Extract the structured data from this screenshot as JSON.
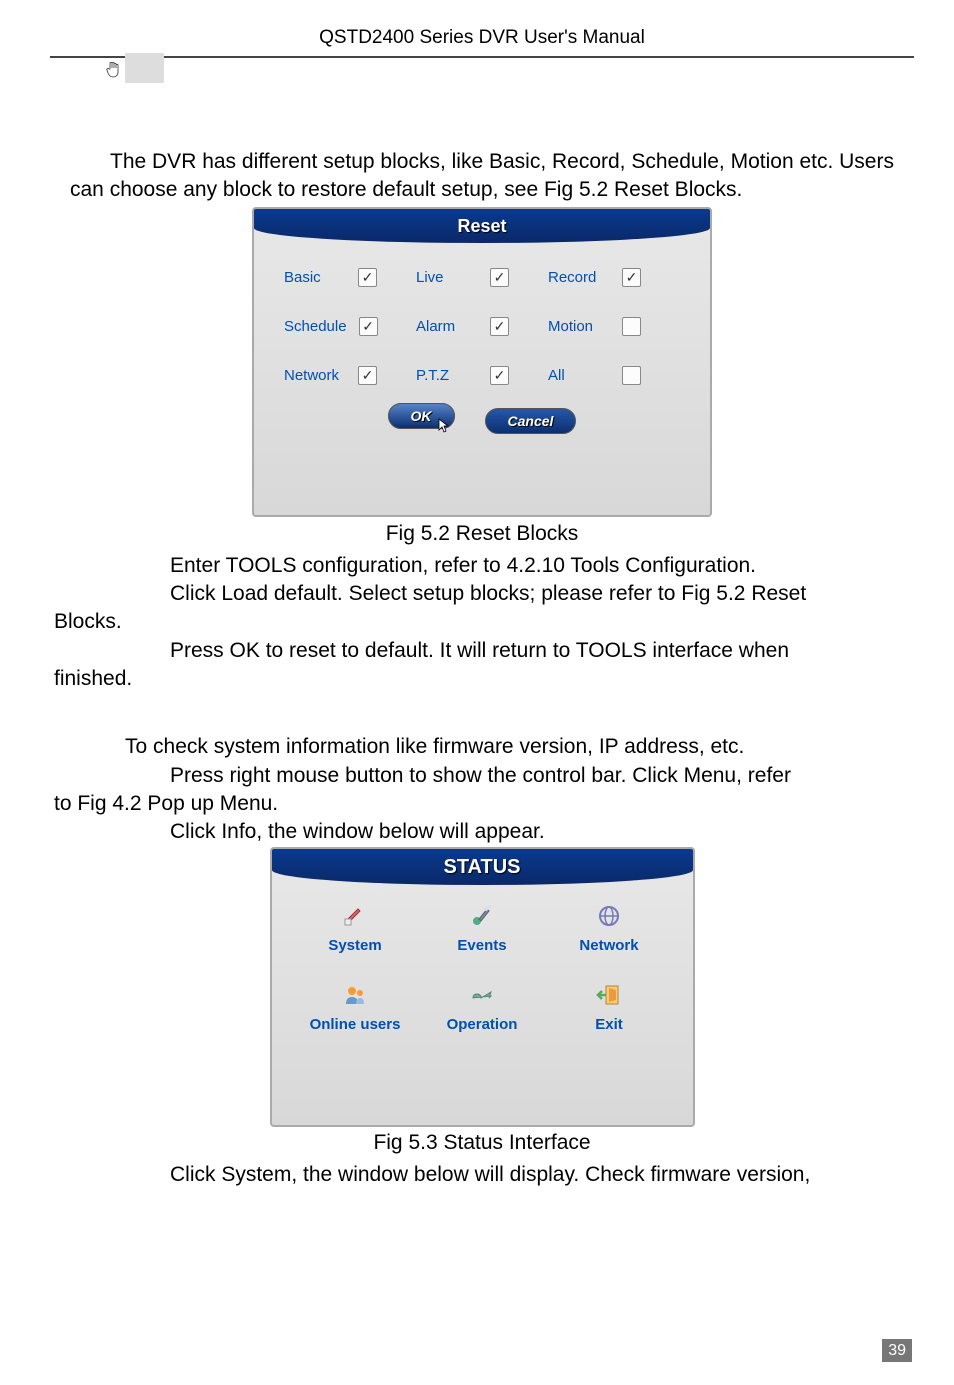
{
  "header": {
    "title": "QSTD2400 Series DVR User's Manual"
  },
  "page_number": "39",
  "paragraphs": {
    "p1": "The DVR has different setup blocks, like Basic, Record, Schedule, Motion etc. Users can choose any block to restore default setup, see Fig 5.2 Reset Blocks.",
    "caption1": "Fig 5.2 Reset Blocks",
    "p2": "Enter TOOLS configuration, refer to 4.2.10 Tools Configuration.",
    "p3a": "Click Load default. Select setup blocks; please refer to Fig 5.2 Reset",
    "p3b": "Blocks.",
    "p4a": "Press OK to reset to default. It will return to TOOLS interface when",
    "p4b": "finished.",
    "p5": "To check system information like firmware version, IP address, etc.",
    "p6a": "Press right mouse button to show the control bar. Click Menu, refer",
    "p6b": "to Fig 4.2 Pop up Menu.",
    "p7": "Click Info, the window below will appear.",
    "caption2": "Fig 5.3 Status Interface",
    "p8": "Click System, the window below will display. Check firmware version,"
  },
  "reset_panel": {
    "title": "Reset",
    "options": {
      "basic": {
        "label": "Basic",
        "checked": true
      },
      "live": {
        "label": "Live",
        "checked": true
      },
      "record": {
        "label": "Record",
        "checked": true
      },
      "schedule": {
        "label": "Schedule",
        "checked": true
      },
      "alarm": {
        "label": "Alarm",
        "checked": true
      },
      "motion": {
        "label": "Motion",
        "checked": false
      },
      "network": {
        "label": "Network",
        "checked": true
      },
      "ptz": {
        "label": "P.T.Z",
        "checked": true
      },
      "all": {
        "label": "All",
        "checked": false
      }
    },
    "ok_label": "OK",
    "cancel_label": "Cancel"
  },
  "status_panel": {
    "title": "STATUS",
    "items": {
      "system": {
        "label": "System"
      },
      "events": {
        "label": "Events"
      },
      "network": {
        "label": "Network"
      },
      "online_users": {
        "label": "Online users"
      },
      "operation": {
        "label": "Operation"
      },
      "exit": {
        "label": "Exit"
      }
    }
  }
}
